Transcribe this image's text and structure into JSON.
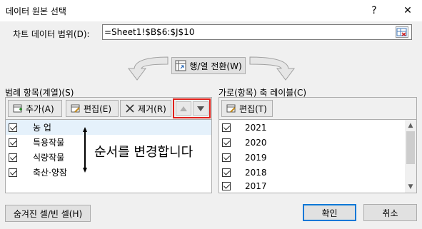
{
  "window": {
    "title": "데이터 원본 선택",
    "help_glyph": "?",
    "close_glyph": "✕"
  },
  "range": {
    "label": "차트 데이터 범위(D):",
    "value": "=Sheet1!$B$6:$J$10"
  },
  "switch_button": {
    "label": "행/열 전환(W)"
  },
  "legend_section": {
    "label": "범례 항목(계열)(S)",
    "add_label": "추가(A)",
    "edit_label": "편집(E)",
    "remove_label": "제거(R)",
    "items": [
      {
        "label": "농 업",
        "checked": true,
        "selected": true
      },
      {
        "label": "특용작물",
        "checked": true,
        "selected": false
      },
      {
        "label": "식량작물",
        "checked": true,
        "selected": false
      },
      {
        "label": "축산·양잠",
        "checked": true,
        "selected": false
      }
    ]
  },
  "axis_section": {
    "label": "가로(항목) 축 레이블(C)",
    "edit_label": "편집(T)",
    "items": [
      {
        "label": "2021",
        "checked": true
      },
      {
        "label": "2020",
        "checked": true
      },
      {
        "label": "2019",
        "checked": true
      },
      {
        "label": "2018",
        "checked": true
      },
      {
        "label": "2017",
        "checked": true
      }
    ]
  },
  "annotation": {
    "text": "순서를 변경합니다"
  },
  "buttons": {
    "hidden_cells": "숨겨진 셀/빈 셀(H)",
    "ok": "확인",
    "cancel": "취소"
  },
  "colors": {
    "highlight_border": "#e0201a",
    "selected_row": "#e5f1fb",
    "default_button_border": "#0078d7"
  }
}
